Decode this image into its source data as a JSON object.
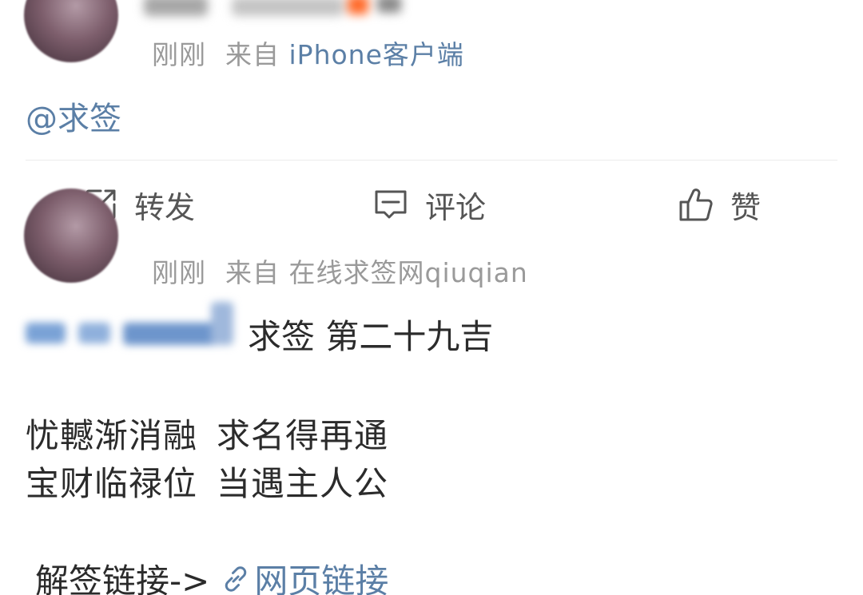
{
  "post1": {
    "time": "刚刚",
    "from_label": "来自",
    "source": "iPhone客户端",
    "mention": "@求签"
  },
  "actions": {
    "forward_label": "转发",
    "comment_label": "评论",
    "like_label": "赞"
  },
  "post2": {
    "time": "刚刚",
    "from_label": "来自",
    "source": "在线求签网qiuqian",
    "fortune_title": "求签 第二十九吉",
    "poem_line1_a": "忧轗渐消融",
    "poem_line1_b": "求名得再通",
    "poem_line2_a": "宝财临禄位",
    "poem_line2_b": "当遇主人公",
    "link_prefix": "解签链接->",
    "link_text": "网页链接"
  },
  "colors": {
    "link_blue": "#5b7fa6",
    "meta_gray": "#9a9a9a",
    "text_dark": "#2b2b2b"
  }
}
